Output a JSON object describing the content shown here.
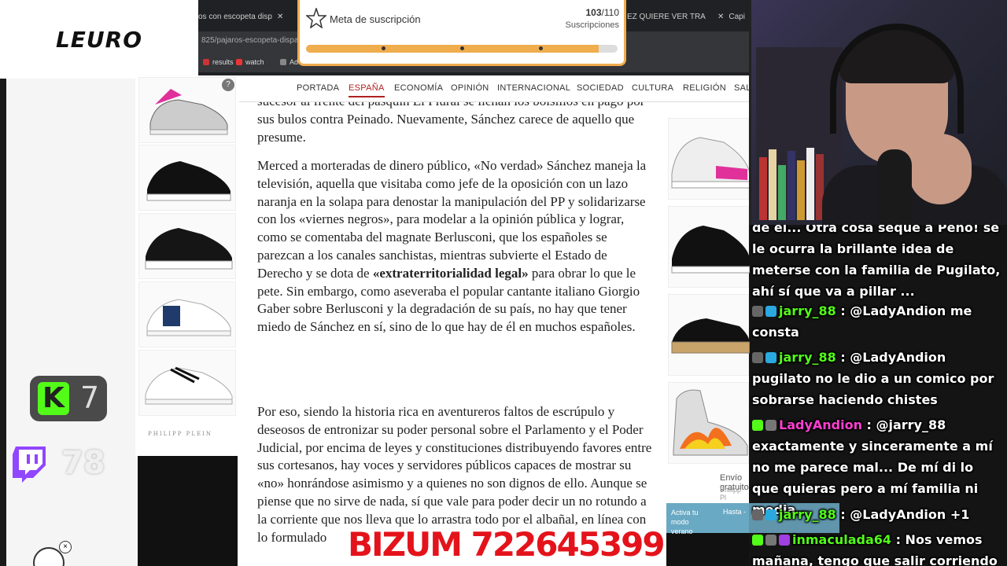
{
  "logo": {
    "text": "LEURO"
  },
  "browser": {
    "tab1": "os con escopeta disp",
    "tab2": "EZ QUIERE VER TRA",
    "tab3": "Capi",
    "url": "825/pajaros-escopeta-dispa",
    "bookmarks": [
      {
        "label": "results"
      },
      {
        "label": "watch"
      },
      {
        "label": "Ad"
      }
    ]
  },
  "subscription": {
    "title": "Meta de suscripción",
    "current": "103",
    "goal": "/110",
    "label": "Suscripciones",
    "progress": 0.94
  },
  "site_nav": [
    "PORTADA",
    "ESPAÑA",
    "ECONOMÍA",
    "OPINIÓN",
    "INTERNACIONAL",
    "SOCIEDAD",
    "CULTURA",
    "RELIGIÓN",
    "SAL"
  ],
  "ad_left": {
    "brand": "PHILIPP PLEIN",
    "badge": "?"
  },
  "ad_right": {
    "shipping": "Envío gratuito",
    "brand": "Philipp Pl",
    "activate": "Activa tu modo verano",
    "until": "Hasta -"
  },
  "article": {
    "p0": "sucesor al frente del pasquín El Plural se llenan los bolsillos en pago por sus bulos contra Peinado. Nuevamente, Sánchez carece de aquello que presume.",
    "p1_a": "Merced a morteradas de dinero público, «No verdad» Sánchez maneja la televisión, aquella que visitaba como jefe de la oposición con un lazo naranja en la solapa para denostar la manipulación del PP y solidarizarse con los «viernes negros», para modelar a la opinión pública y lograr, como se comentaba del magnate Berlusconi, que los españoles se parezcan a los canales sanchistas, mientras subvierte el Estado de Derecho y se dota de ",
    "p1_bold": "«extraterritorialidad legal»",
    "p1_b": " para obrar lo que le pete. Sin embargo, como aseveraba el popular cantante italiano Giorgio Gaber sobre Berlusconi y la degradación de su país, no hay que tener miedo de Sánchez en sí, sino de lo que hay de él en muchos españoles.",
    "p2": "Por eso, siendo la historia rica en aventureros faltos de escrúpulo y deseosos de entronizar su poder personal sobre el Parlamento y el Poder Judicial, por encima de leyes y constituciones distribuyendo favores entre sus cortesanos, hay voces y servidores públicos capaces de mostrar su «no» honrándose asimismo y a quienes no son dignos de ello. Aunque se piense que no sirve de nada, sí que vale para poder decir un no rotundo a la corriente que nos lleva que lo arrastra todo por el albañal, en línea con lo formulado"
  },
  "overlays": {
    "kick_letter": "K",
    "kick_count": "7",
    "twitch_count": "78",
    "close": "×",
    "bizum": "BIZUM 722645399"
  },
  "chat": [
    {
      "user": "",
      "text": "de él... Otra cosa seque a Peñó! se le ocurra la brillante idea de meterse con la familia de Pugilato, ahí sí que va a pillar ..."
    },
    {
      "user": "jarry_88",
      "text": " : @LadyAndion me consta"
    },
    {
      "user": "jarry_88",
      "text": " : @LadyAndion pugilato no le dio a un comico por sobrarse haciendo chistes"
    },
    {
      "user": "LadyAndion",
      "text": " : @jarry_88 exactamente y sinceramente a mí no me parece mal... De mí di lo que quieras pero a mí familia ni media..."
    },
    {
      "user": "jarry_88",
      "text": " : @LadyAndion +1"
    },
    {
      "user": "inmaculada64",
      "text": " : Nos vemos mañana, tengo que salir corriendo 🤭"
    }
  ],
  "colors": {
    "accent_sub": "#f0ad4e",
    "kick": "#53fc18",
    "twitch": "#9146ff",
    "bizum": "#e4131b",
    "nav_active": "#b02020"
  }
}
